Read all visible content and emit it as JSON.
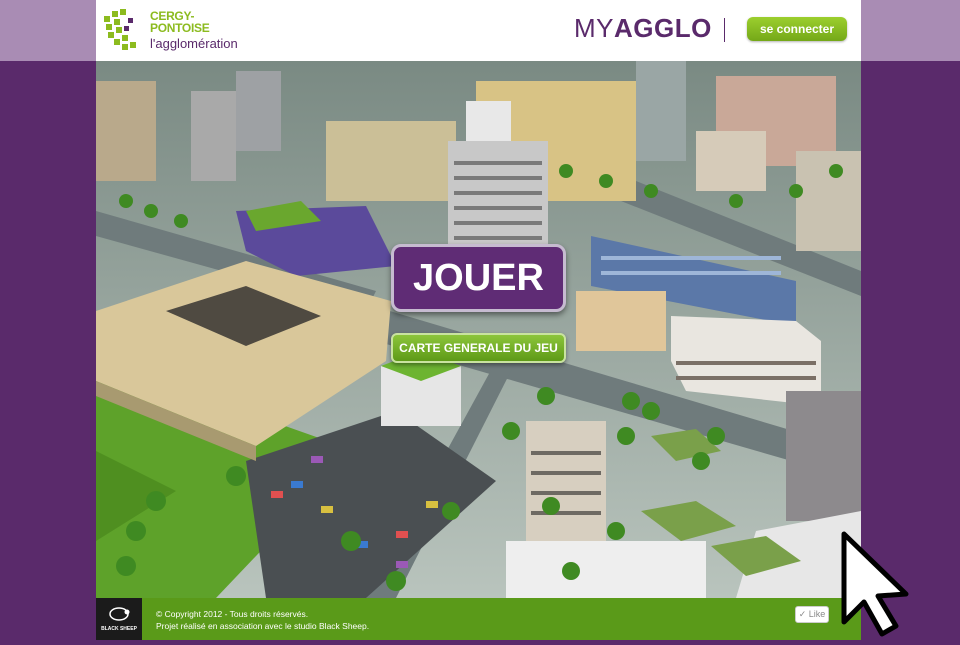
{
  "header": {
    "logo_name": "CERGY-PONTOISE",
    "logo_sub": "l'agglomération",
    "brand_prefix": "MY",
    "brand_main": "AGGLO",
    "connect_label": "se connecter"
  },
  "main": {
    "play_label": "JOUER",
    "map_label": "CARTE GENERALE DU JEU"
  },
  "footer": {
    "logo_text": "BLACK SHEEP",
    "copyright": "© Copyright 2012 - Tous droits réservés.",
    "credit": "Projet réalisé en association avec le studio Black Sheep.",
    "like_label": "Like"
  },
  "colors": {
    "purple": "#5a2a6b",
    "green": "#8cbb1f"
  }
}
